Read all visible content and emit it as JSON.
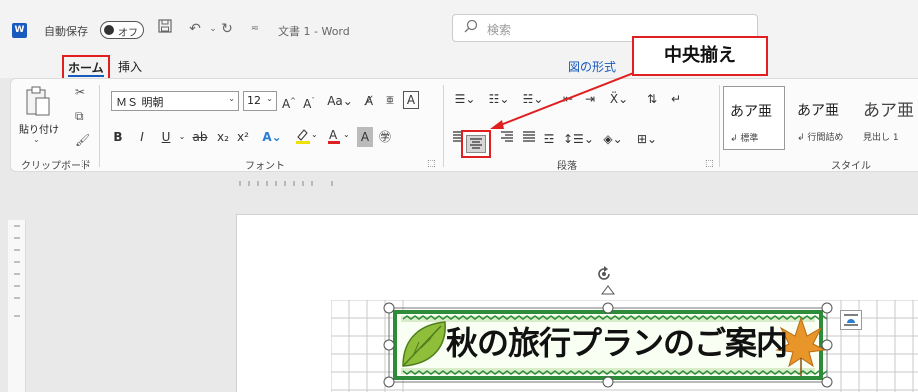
{
  "titlebar": {
    "app_icon": "W",
    "autosave_label": "自動保存",
    "autosave_state": "オフ",
    "doc_title": "文書 1  -  Word",
    "search_placeholder": "検索"
  },
  "tabs": [
    {
      "label": "ホーム",
      "active": true
    },
    {
      "label": "挿入"
    },
    {
      "label": "図の形式"
    }
  ],
  "clipboard": {
    "paste_label": "貼り付け",
    "group_label": "クリップボード"
  },
  "font": {
    "name": "ＭＳ 明朝",
    "size": "12",
    "group_label": "フォント",
    "buttons": [
      "B",
      "I",
      "U",
      "ab",
      "x₂",
      "x²"
    ]
  },
  "paragraph": {
    "group_label": "段落"
  },
  "styles": {
    "group_label": "スタイル",
    "items": [
      {
        "preview": "あア亜",
        "name": "標準"
      },
      {
        "preview": "あア亜",
        "name": "行間詰め"
      },
      {
        "preview": "あア亜",
        "name": "見出し 1"
      }
    ]
  },
  "callout": {
    "text": "中央揃え"
  },
  "document": {
    "banner_title": "秋の旅行プランのご案内"
  },
  "colors": {
    "accent_red": "#e02020",
    "word_blue": "#185abd",
    "leaf_green": "#2e8b3a",
    "maple_orange": "#e8962a"
  }
}
